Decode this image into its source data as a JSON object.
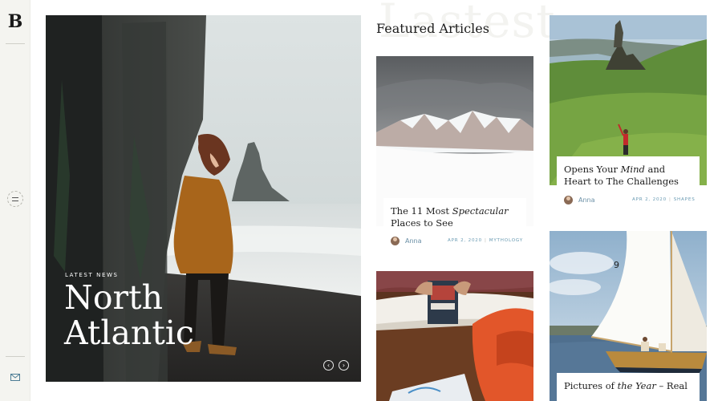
{
  "brand": {
    "logo": "B",
    "ghost_word": "Lastest"
  },
  "hero": {
    "eyebrow": "LATEST NEWS",
    "title_line1": "North",
    "title_line2": "Atlantic",
    "prev_icon": "arrow-left-icon",
    "next_icon": "arrow-right-icon"
  },
  "featured": {
    "heading": "Featured Articles",
    "cards": [
      {
        "title_prefix": "The 11 Most ",
        "title_em": "Spectacular",
        "title_suffix": " Places to See",
        "author": "Anna",
        "date": "APR 2, 2020",
        "category": "MYTHOLOGY"
      },
      {
        "title_prefix": "Opens Your ",
        "title_em": "Mind",
        "title_suffix": " and Heart to The Challenges",
        "author": "Anna",
        "date": "APR 2, 2020",
        "category": "SHAPES"
      },
      {
        "title_prefix": "Pictures of ",
        "title_em": "the Year",
        "title_suffix": " – Real"
      }
    ]
  },
  "sidebar": {
    "menu_icon": "hamburger-menu-icon",
    "mail_icon": "mail-icon"
  },
  "colors": {
    "rail_bg": "#f4f4f0",
    "meta_blue": "#6a9bb3"
  }
}
